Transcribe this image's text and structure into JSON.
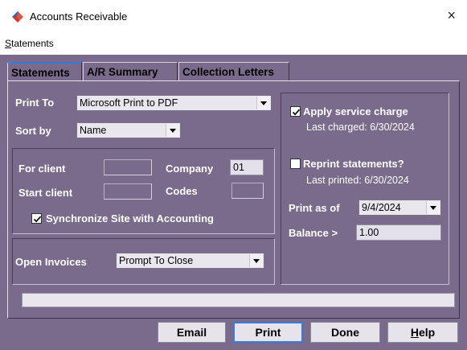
{
  "window": {
    "title": "Accounts Receivable",
    "close_glyph": "×"
  },
  "menu": {
    "statements_first": "S",
    "statements_rest": "tatements"
  },
  "tabs": [
    {
      "label": "Statements"
    },
    {
      "label": "A/R Summary"
    },
    {
      "label": "Collection Letters"
    }
  ],
  "left": {
    "print_to_label": "Print To",
    "print_to_value": "Microsoft Print to PDF",
    "sort_by_label": "Sort by",
    "sort_by_value": "Name",
    "for_client_label": "For client",
    "for_client_value": "",
    "company_label": "Company",
    "company_value": "01",
    "start_client_label": "Start client",
    "start_client_value": "",
    "codes_label": "Codes",
    "codes_value": "",
    "sync_label": "Synchronize Site with Accounting",
    "sync_checked": true,
    "open_invoices_label": "Open Invoices",
    "open_invoices_value": "Prompt To Close"
  },
  "right": {
    "apply_service_label": "Apply service charge",
    "apply_service_checked": true,
    "last_charged": "Last charged: 6/30/2024",
    "reprint_label": "Reprint statements?",
    "reprint_checked": false,
    "last_printed": "Last printed: 6/30/2024",
    "print_as_of_label": "Print as of",
    "print_as_of_value": "9/4/2024",
    "balance_label": "Balance >",
    "balance_value": "1.00"
  },
  "buttons": {
    "email": "Email",
    "print": "Print",
    "done": "Done",
    "help_first": "H",
    "help_rest": "elp"
  },
  "colors": {
    "panel": "#7a6b8d",
    "accent": "#3a7bd5"
  }
}
